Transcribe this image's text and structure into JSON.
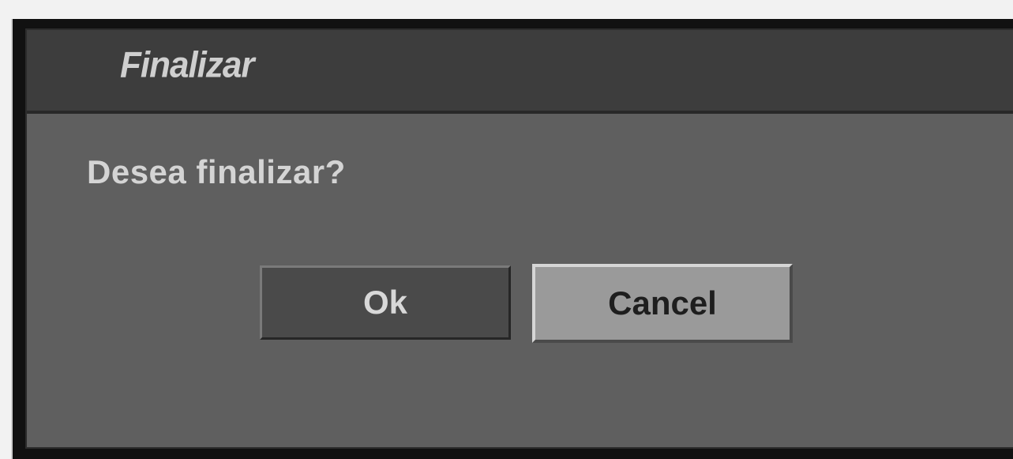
{
  "dialog": {
    "title": "Finalizar",
    "message": "Desea finalizar?",
    "buttons": {
      "ok_label": "Ok",
      "cancel_label": "Cancel"
    },
    "focused_button": "cancel"
  },
  "colors": {
    "title_bar": "#3d3d3d",
    "dialog_body": "#5f5f5f",
    "ok_button": "#4a4a4a",
    "cancel_button_highlighted": "#9a9a9a",
    "text_light": "#d4d4d4",
    "text_dark": "#1e1e1e"
  }
}
